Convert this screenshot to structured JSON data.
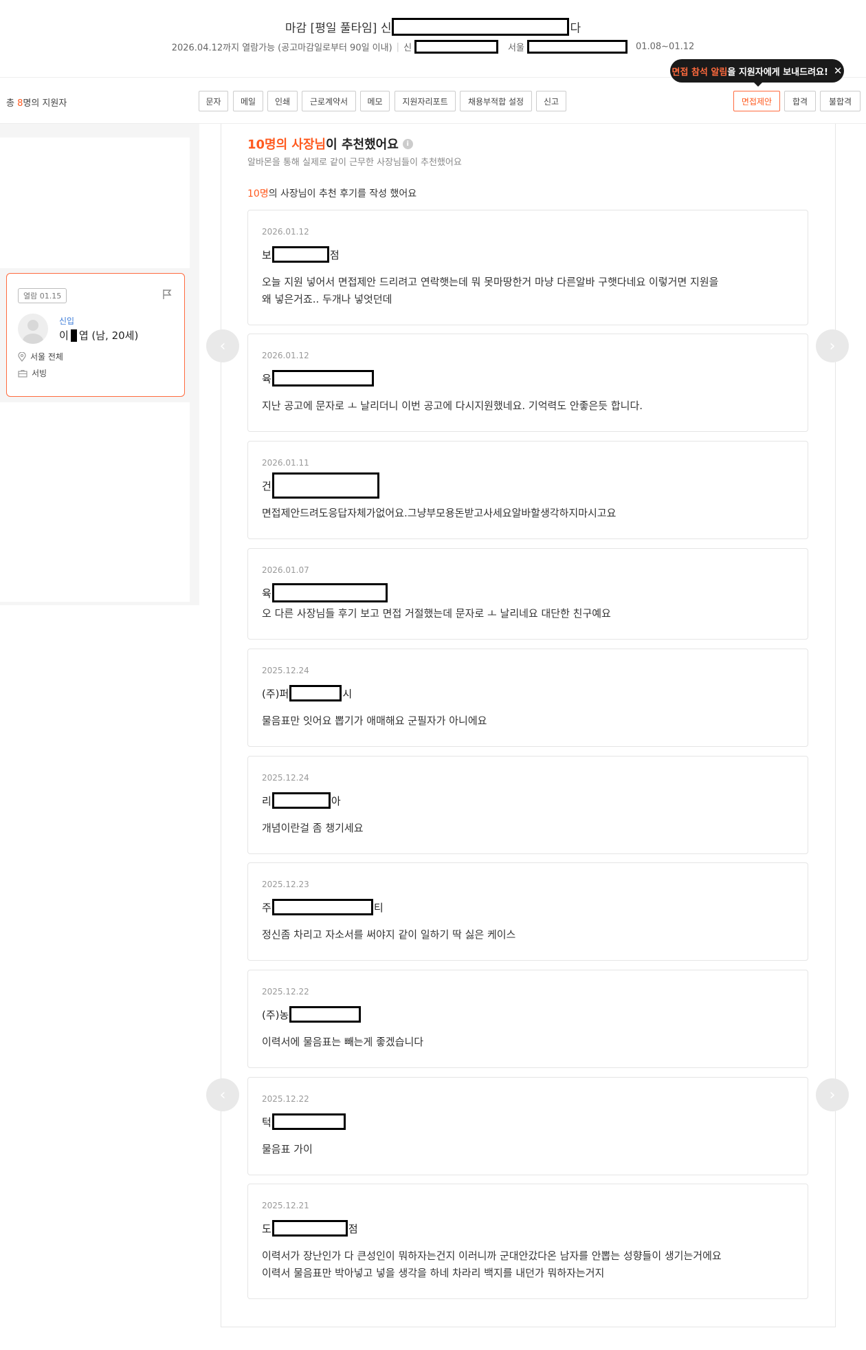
{
  "header": {
    "title_prefix": "마감 [평일 풀타임] 신",
    "title_suffix": "다",
    "sub_open": "2026.04.12까지 열람가능 (공고마감일로부터 90일 이내)",
    "sub_loc_prefix": "신",
    "sub_region": "서울",
    "sub_period": "01.08~01.12"
  },
  "tooltip": {
    "highlight": "면접 참석 알림",
    "rest": "을 지원자에게 보내드려요!",
    "close": "✕"
  },
  "toolbar": {
    "total_prefix": "총 ",
    "total_num": "8",
    "total_suffix": "명의 지원자",
    "buttons": [
      "문자",
      "메일",
      "인쇄",
      "근로계약서",
      "메모",
      "지원자리포트",
      "채용부적합 설정",
      "신고"
    ],
    "right_buttons": [
      "면접제안",
      "합격",
      "불합격"
    ]
  },
  "applicant": {
    "badge": "열람 01.15",
    "tag": "신입",
    "name_prefix": "이",
    "name_suffix": "엽 (남, 20세)",
    "location": "서울 전체",
    "job": "서빙"
  },
  "recommend": {
    "title_hl": "10명의 사장님",
    "title_rest": "이 추천했어요",
    "info": "i",
    "subtitle": "알바몬을 통해 실제로 같이 근무한 사장님들이 추천했어요",
    "count_hl": "10명",
    "count_rest": "의 사장님이 추천 후기를 작성 했어요"
  },
  "reviews": [
    {
      "date": "2026.01.12",
      "name_prefix": "보",
      "name_suffix": "점",
      "lines": [
        "오늘 지원 넣어서 면접제안 드리려고 연락햇는데 뭐 못마땅한거 마냥 다른알바 구햇다네요 이렇거면 지원을",
        "왜 넣은거죠.. 두개나 넣엇던데"
      ]
    },
    {
      "date": "2026.01.12",
      "name_prefix": "육",
      "name_suffix": "",
      "lines": [
        "지난 공고에 문자로 ㅗ 날리더니 이번 공고에 다시지원했네요. 기억력도 안좋은듯 합니다."
      ]
    },
    {
      "date": "2026.01.11",
      "name_prefix": "건",
      "name_suffix": "",
      "lines": [
        "면접제안드려도응답자체가없어요.그냥부모용돈받고사세요알바할생각하지마시고요"
      ]
    },
    {
      "date": "2026.01.07",
      "name_prefix": "육",
      "name_suffix": "",
      "lines": [
        "오 다른 사장님들 후기 보고 면접 거절했는데 문자로 ㅗ 날리네요 대단한 친구예요"
      ]
    },
    {
      "date": "2025.12.24",
      "name_prefix": "(주)퍼",
      "name_suffix": "시",
      "lines": [
        "물음표만 잇어요 뽑기가 애매해요 군필자가 아니에요"
      ]
    },
    {
      "date": "2025.12.24",
      "name_prefix": "리",
      "name_suffix": "아",
      "lines": [
        "개념이란걸 좀 챙기세요"
      ]
    },
    {
      "date": "2025.12.23",
      "name_prefix": "주",
      "name_suffix": "티",
      "lines": [
        "정신좀 차리고 자소서를 써야지 같이 일하기 딱 싫은 케이스"
      ]
    },
    {
      "date": "2025.12.22",
      "name_prefix": "(주)농",
      "name_suffix": "",
      "lines": [
        "이력서에 물음표는 빼는게 좋겠습니다"
      ]
    },
    {
      "date": "2025.12.22",
      "name_prefix": "턱",
      "name_suffix": "",
      "lines": [
        "물음표 가이"
      ]
    },
    {
      "date": "2025.12.21",
      "name_prefix": "도",
      "name_suffix": "점",
      "lines": [
        "이력서가 장난인가 다 큰성인이 뭐하자는건지 이러니까 군대안갔다온 남자를 안뽑는 성향들이 생기는거에요",
        "이력서 물음표만 박아넣고 넣을 생각을 하네 차라리 백지를 내던가 뭐하자는거지"
      ]
    }
  ],
  "nav": {
    "prev": "‹",
    "next": "›"
  }
}
